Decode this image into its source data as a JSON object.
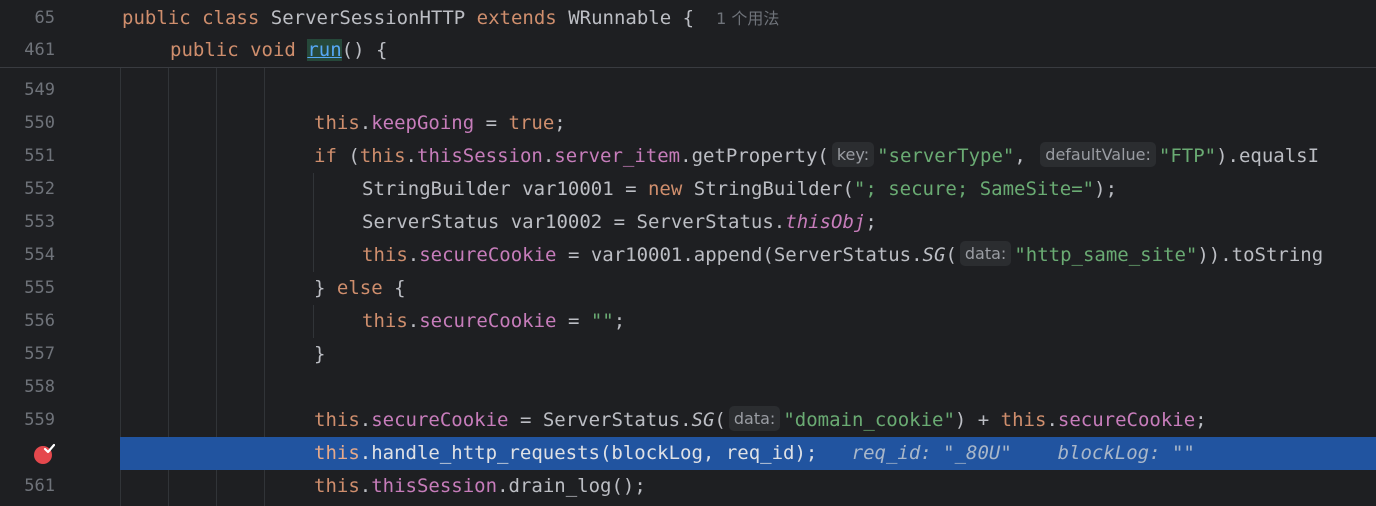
{
  "sticky": {
    "line65": {
      "num": "65",
      "kw_public": "public",
      "kw_class": "class",
      "class_name": "ServerSessionHTTP",
      "kw_extends": "extends",
      "parent": "WRunnable",
      "brace": "{",
      "usages": "1 个用法"
    },
    "line461": {
      "num": "461",
      "kw_public": "public",
      "kw_void": "void",
      "method": "run",
      "rest": "() {"
    }
  },
  "lines": {
    "l549": {
      "num": "549"
    },
    "l550": {
      "num": "550",
      "this": "this",
      "dot": ".",
      "field": "keepGoing",
      "op": " = ",
      "val": "true",
      "end": ";"
    },
    "l551": {
      "num": "551",
      "kw_if": "if",
      "p1": " (",
      "this": "this",
      "dot1": ".",
      "field1": "thisSession",
      "dot2": ".",
      "field2": "server_item",
      "call": ".getProperty(",
      "hint_key": "key:",
      "str1": "\"serverType\"",
      "comma": ",",
      "hint_default": "defaultValue:",
      "str2": "\"FTP\"",
      "tail": ").equalsI"
    },
    "l552": {
      "num": "552",
      "type": "StringBuilder var10001 = ",
      "kw_new": "new",
      "ctor": " StringBuilder(",
      "str": "\"; secure; SameSite=\"",
      "end": ");"
    },
    "l553": {
      "num": "553",
      "pre": "ServerStatus var10002 = ServerStatus.",
      "static": "thisObj",
      "end": ";"
    },
    "l554": {
      "num": "554",
      "this": "this",
      "dot": ".",
      "field": "secureCookie",
      "mid": " = var10001.append(ServerStatus.",
      "sg": "SG",
      "paren": "(",
      "hint_data": "data:",
      "str": "\"http_same_site\"",
      "tail": ")).toString"
    },
    "l555": {
      "num": "555",
      "brace": "} ",
      "kw_else": "else",
      "rest": " {"
    },
    "l556": {
      "num": "556",
      "this": "this",
      "dot": ".",
      "field": "secureCookie",
      "op": " = ",
      "str": "\"\"",
      "end": ";"
    },
    "l557": {
      "num": "557",
      "brace": "}"
    },
    "l558": {
      "num": "558"
    },
    "l559": {
      "num": "559",
      "this1": "this",
      "dot1": ".",
      "field1": "secureCookie",
      "mid": " = ServerStatus.",
      "sg": "SG",
      "paren": "(",
      "hint_data": "data:",
      "str": "\"domain_cookie\"",
      "plus": ") + ",
      "this2": "this",
      "dot2": ".",
      "field2": "secureCookie",
      "end": ";"
    },
    "l560": {
      "this": "this",
      "call": ".handle_http_requests(blockLog, req_id);",
      "dbg1": "req_id: \"_80U\"",
      "dbg2": "blockLog: \"\""
    },
    "l561": {
      "num": "561",
      "this": "this",
      "dot1": ".",
      "field": "thisSession",
      "call": ".drain_log();"
    }
  },
  "colors": {
    "background": "#1e1f22",
    "keyword": "#cf8e6d",
    "field": "#c77dbb",
    "string": "#6aab73",
    "execution_line": "#2154a0",
    "breakpoint": "#e5484d"
  }
}
